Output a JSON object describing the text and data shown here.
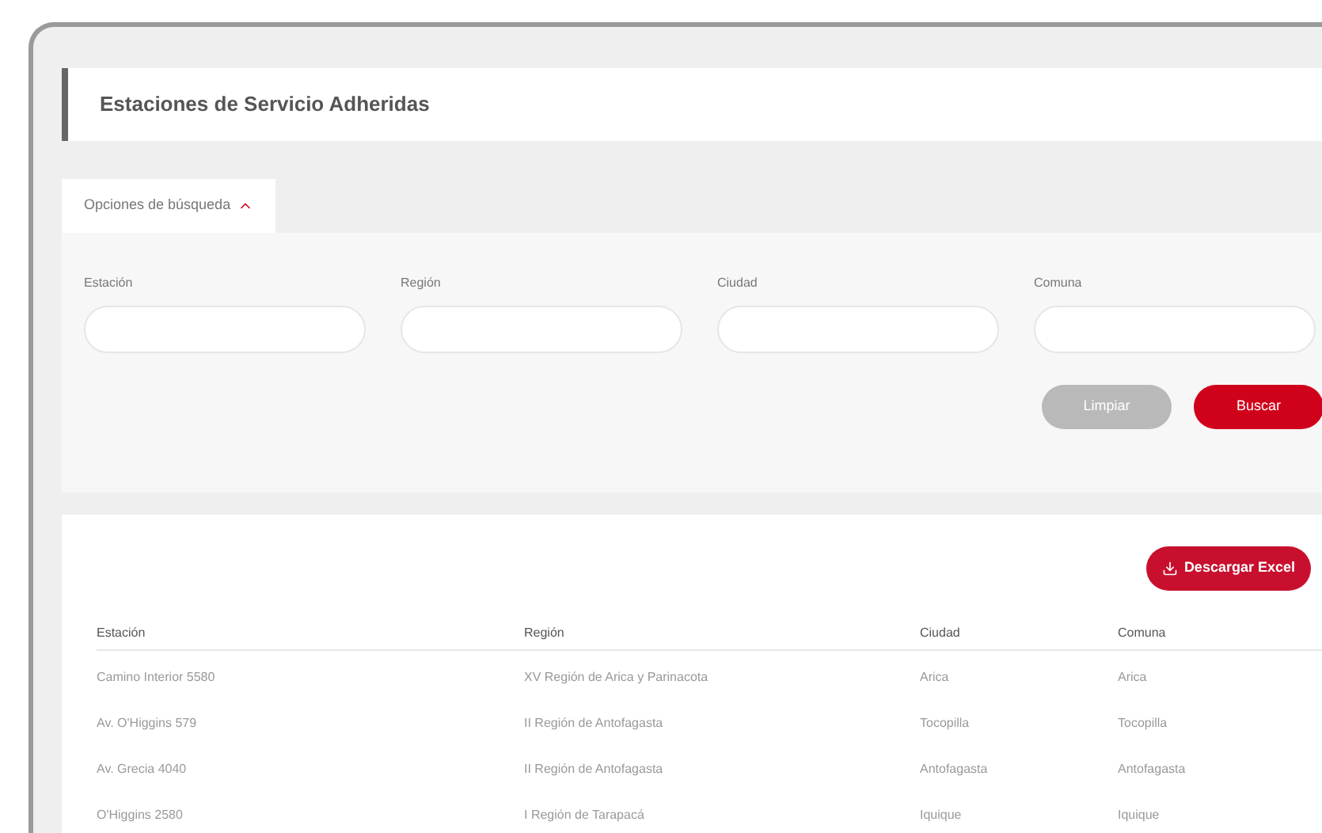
{
  "page_title": "Estaciones de Servicio Adheridas",
  "search_tab": {
    "label": "Opciones de búsqueda",
    "expanded": true
  },
  "filters": [
    {
      "label": "Estación"
    },
    {
      "label": "Región"
    },
    {
      "label": "Ciudad"
    },
    {
      "label": "Comuna"
    }
  ],
  "buttons": [
    {
      "label": "Limpiar",
      "kind": "secondary"
    },
    {
      "label": "Buscar",
      "kind": "primary"
    }
  ],
  "download_button": "Descargar Excel",
  "table": {
    "columns": [
      "Estación",
      "Región",
      "Ciudad",
      "Comuna"
    ],
    "rows": [
      [
        "Camino Interior 5580",
        "XV Región de Arica y Parinacota",
        "Arica",
        "Arica"
      ],
      [
        "Av. O'Higgins 579",
        "II Región de Antofagasta",
        "Tocopilla",
        "Tocopilla"
      ],
      [
        "Av. Grecia 4040",
        "II Región de Antofagasta",
        "Antofagasta",
        "Antofagasta"
      ],
      [
        "O'Higgins 2580",
        "I Región de Tarapacá",
        "Iquique",
        "Iquique"
      ]
    ]
  }
}
